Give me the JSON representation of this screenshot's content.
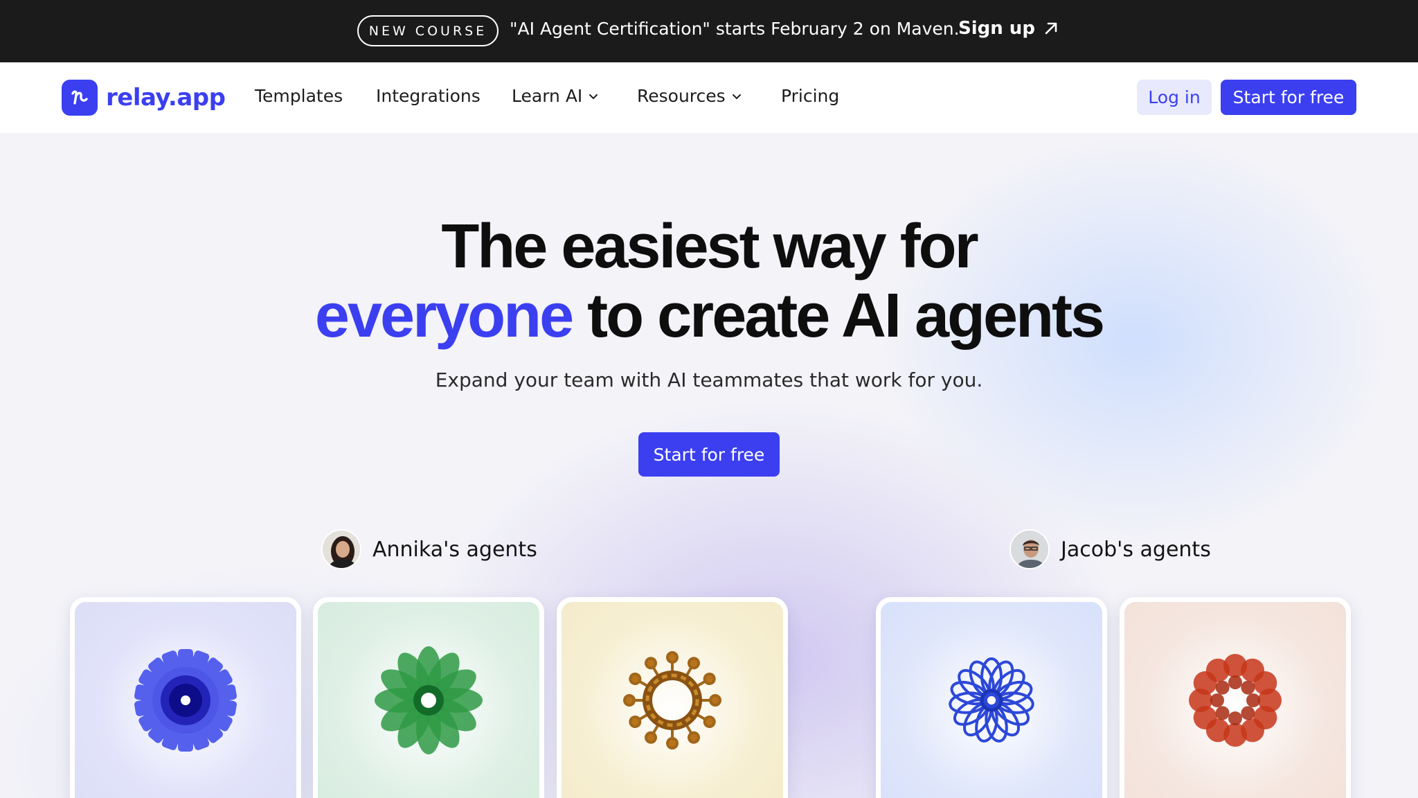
{
  "announcement": {
    "badge": "NEW COURSE",
    "message": "\"AI Agent Certification\" starts February 2 on Maven.",
    "cta": "Sign up"
  },
  "nav": {
    "logo_text": "relay.app",
    "items": [
      "Templates",
      "Integrations",
      "Learn AI",
      "Resources",
      "Pricing"
    ],
    "login": "Log in",
    "start": "Start for free"
  },
  "hero": {
    "line1": "The easiest way for",
    "line2_accent": "everyone",
    "line2_rest": " to create AI agents",
    "subtitle": "Expand your team with AI teammates that work for you.",
    "cta": "Start for free"
  },
  "agents": [
    {
      "owner": "Annika's agents"
    },
    {
      "owner": "Jacob's agents"
    }
  ],
  "colors": {
    "brand": "#3b3ff0",
    "dark_bar": "#1b1b1b"
  }
}
